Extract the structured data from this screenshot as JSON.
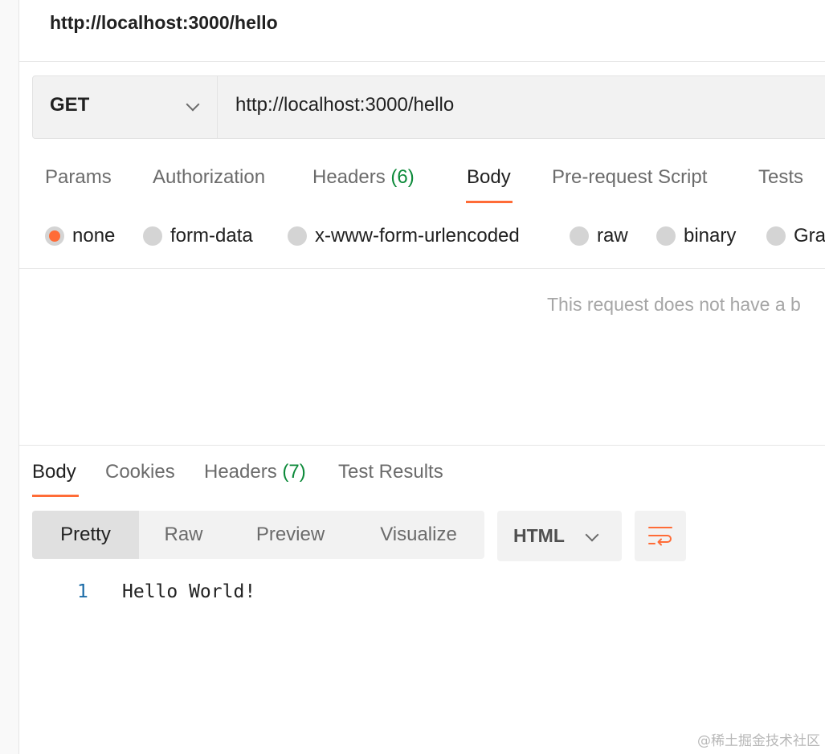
{
  "request": {
    "title": "http://localhost:3000/hello",
    "method": "GET",
    "url": "http://localhost:3000/hello",
    "tabs": [
      {
        "label": "Params",
        "count": ""
      },
      {
        "label": "Authorization",
        "count": ""
      },
      {
        "label": "Headers",
        "count": "(6)"
      },
      {
        "label": "Body",
        "count": ""
      },
      {
        "label": "Pre-request Script",
        "count": ""
      },
      {
        "label": "Tests",
        "count": ""
      }
    ],
    "active_tab": "Body",
    "body_types": [
      "none",
      "form-data",
      "x-www-form-urlencoded",
      "raw",
      "binary",
      "Gra"
    ],
    "selected_body_type": "none",
    "empty_message": "This request does not have a b"
  },
  "response": {
    "tabs": [
      {
        "label": "Body",
        "count": ""
      },
      {
        "label": "Cookies",
        "count": ""
      },
      {
        "label": "Headers",
        "count": "(7)"
      },
      {
        "label": "Test Results",
        "count": ""
      }
    ],
    "active_tab": "Body",
    "view_modes": [
      "Pretty",
      "Raw",
      "Preview",
      "Visualize"
    ],
    "active_view": "Pretty",
    "format": "HTML",
    "lines": [
      {
        "num": "1",
        "text": "Hello World!"
      }
    ]
  },
  "watermark": "@稀土掘金技术社区",
  "colors": {
    "accent": "#ff6c37",
    "count_green": "#0d8a3a",
    "line_number": "#1c6ca8"
  }
}
